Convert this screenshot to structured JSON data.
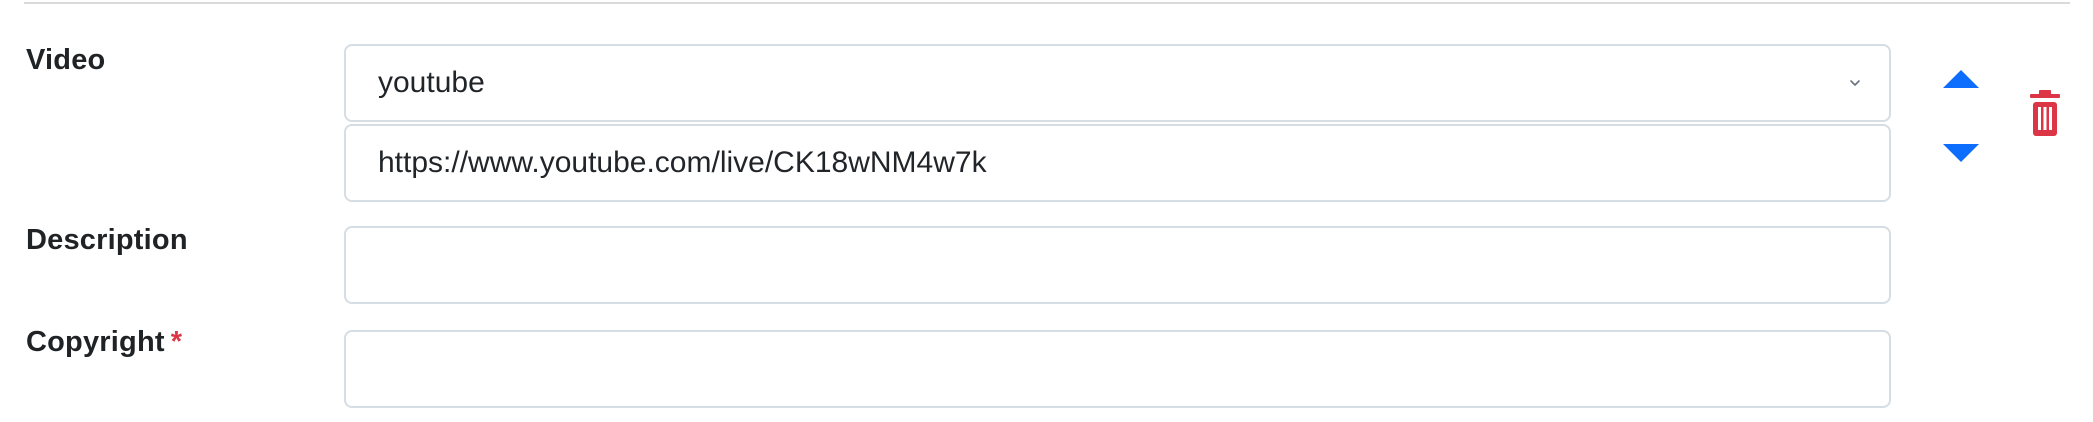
{
  "labels": {
    "video": "Video",
    "description": "Description",
    "copyright": "Copyright",
    "required_marker": "*"
  },
  "video": {
    "provider": "youtube",
    "url": "https://www.youtube.com/live/CK18wNM4w7k"
  },
  "description": {
    "value": ""
  },
  "copyright": {
    "value": ""
  },
  "controls": {
    "move_up_icon": "caret-up-icon",
    "move_down_icon": "caret-down-icon",
    "delete_icon": "trash-icon",
    "select_icon": "chevron-down-icon"
  },
  "colors": {
    "accent_blue": "#0d6efd",
    "danger_red": "#dc3545",
    "border": "#d6dde3"
  }
}
